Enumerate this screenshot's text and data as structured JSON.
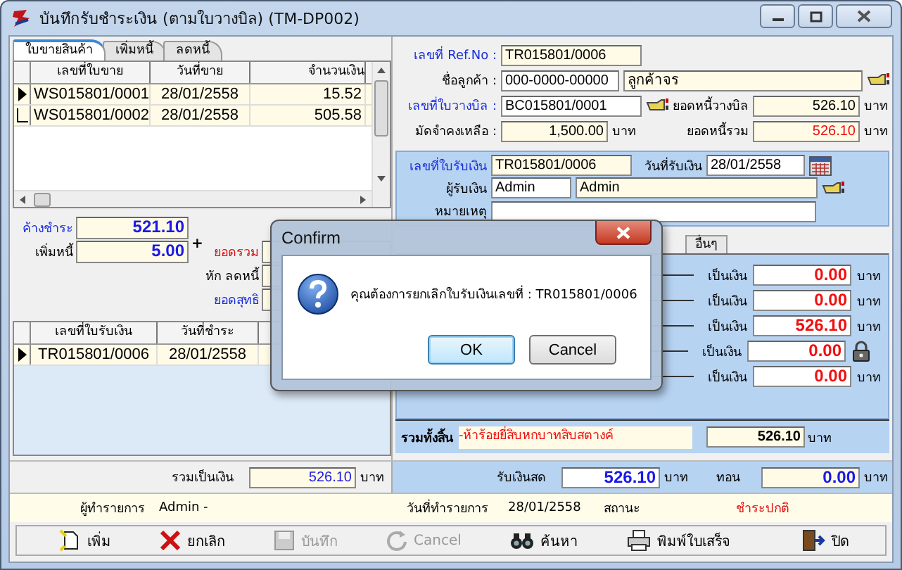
{
  "window": {
    "title": "บันทึกรับชำระเงิน (ตามใบวางบิล) (TM-DP002)"
  },
  "doc_tabs": [
    {
      "label": "ใบขายสินค้า",
      "selected": true
    },
    {
      "label": "เพิ่มหนี้",
      "selected": false
    },
    {
      "label": "ลดหนี้",
      "selected": false
    }
  ],
  "sales_table": {
    "columns": [
      "เลขที่ใบขาย",
      "วันที่ขาย",
      "จำนวนเงิน"
    ],
    "rows": [
      {
        "current": true,
        "cells": [
          "WS015801/0001",
          "28/01/2558",
          "15.52"
        ]
      },
      {
        "current": false,
        "cells": [
          "WS015801/0002",
          "28/01/2558",
          "505.58"
        ]
      }
    ]
  },
  "totals_left": {
    "outstanding_label": "ค้างชำระ",
    "outstanding": "521.10",
    "add_debt_label": "เพิ่มหนี้",
    "add_debt": "5.00",
    "plus": "+",
    "sum_label": "ยอดรวม",
    "deduct_label": "หัก ลดหนี้",
    "net_label": "ยอดสุทธิ"
  },
  "receipt_table": {
    "columns": [
      "เลขที่ใบรับเงิน",
      "วันที่ชำระ"
    ],
    "rows": [
      {
        "current": true,
        "cells": [
          "TR015801/0006",
          "28/01/2558"
        ]
      }
    ]
  },
  "header": {
    "ref_label": "เลขที่ Ref.No :",
    "ref": "TR015801/0006",
    "customer_label": "ชื่อลูกค้า :",
    "customer_code": "000-0000-00000",
    "customer_name": "ลูกค้าจร",
    "bill_label": "เลขที่ใบวางบิล :",
    "bill": "BC015801/0001",
    "bill_debt_label": "ยอดหนี้วางบิล",
    "bill_debt": "526.10",
    "bill_debt_unit": "บาท",
    "deposit_label": "มัดจำคงเหลือ :",
    "deposit": "1,500.00",
    "deposit_unit": "บาท",
    "total_debt_label": "ยอดหนี้รวม",
    "total_debt": "526.10",
    "total_debt_unit": "บาท"
  },
  "receipt": {
    "no_label": "เลขที่ใบรับเงิน",
    "no": "TR015801/0006",
    "date_label": "วันที่รับเงิน",
    "date": "28/01/2558",
    "receiver_label": "ผู้รับเงิน",
    "receiver_code": "Admin",
    "receiver_name": "Admin",
    "note_label": "หมายเหตุ"
  },
  "payment_tabs": [
    {
      "label": "อื่นๆ",
      "selected": false
    }
  ],
  "payment_rows": [
    {
      "kind": "amount",
      "label": "เป็นเงิน",
      "value": "0.00",
      "unit": "บาท"
    },
    {
      "kind": "amount",
      "label": "เป็นเงิน",
      "value": "0.00",
      "unit": "บาท"
    },
    {
      "kind": "amount",
      "label": "เป็นเงิน",
      "value": "526.10",
      "unit": "บาท"
    },
    {
      "kind": "locked",
      "label": "เป็นเงิน",
      "value": "0.00"
    },
    {
      "kind": "amount",
      "label": "เป็นเงิน",
      "value": "0.00",
      "unit": "บาท"
    }
  ],
  "grand_total": {
    "label": "รวมทั้งสิ้น",
    "words": "-ห้าร้อยยี่สิบหกบาทสิบสตางค์",
    "value": "526.10",
    "unit": "บาท"
  },
  "subtotal": {
    "label": "รวมเป็นเงิน",
    "value": "526.10",
    "unit": "บาท"
  },
  "cash": {
    "label": "รับเงินสด",
    "value": "526.10",
    "unit": "บาท",
    "change_label": "ทอน",
    "change": "0.00",
    "change_unit": "บาท"
  },
  "record": {
    "user_label": "ผู้ทำรายการ",
    "user": "Admin -",
    "date_label": "วันที่ทำรายการ",
    "date": "28/01/2558",
    "status_label": "สถานะ",
    "status": "ชำระปกติ"
  },
  "toolbar": [
    {
      "kind": "new",
      "label": "เพิ่ม",
      "disabled": false
    },
    {
      "kind": "delete",
      "label": "ยกเลิก",
      "disabled": false
    },
    {
      "kind": "save",
      "label": "บันทึก",
      "disabled": true
    },
    {
      "kind": "undo",
      "label": "Cancel",
      "disabled": true
    },
    {
      "kind": "search",
      "label": "ค้นหา",
      "disabled": false
    },
    {
      "kind": "print",
      "label": "พิมพ์ใบเสร็จ",
      "disabled": false
    },
    {
      "kind": "exit",
      "label": "ปิด",
      "disabled": false
    }
  ],
  "dialog": {
    "title": "Confirm",
    "message": "คุณต้องการยกเลิกใบรับเงินเลขที่ : TR015801/0006",
    "buttons": [
      {
        "label": "OK",
        "selected": true
      },
      {
        "label": "Cancel",
        "selected": false
      }
    ]
  }
}
